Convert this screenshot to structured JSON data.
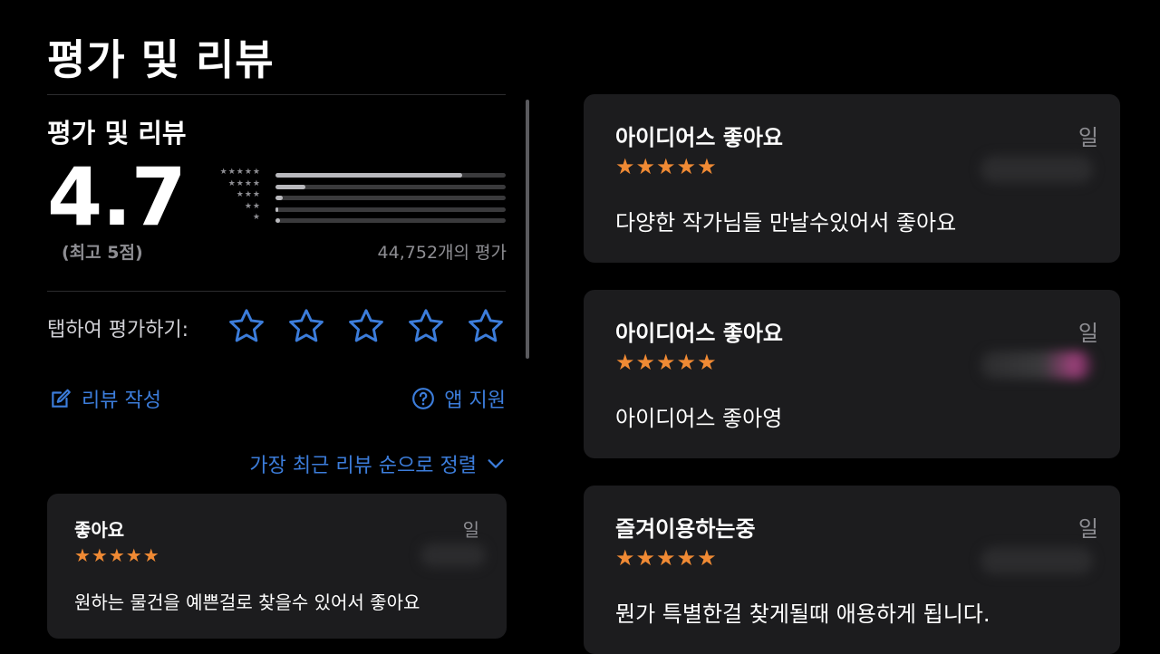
{
  "page": {
    "title": "평가 및 리뷰"
  },
  "summary": {
    "title": "평가 및 리뷰",
    "rating": "4.7",
    "out_of": "(최고 5점)",
    "count_text": "44,752개의 평가",
    "histogram": [
      {
        "stars": "★★★★★",
        "fraction": 0.81
      },
      {
        "stars": "★★★★",
        "fraction": 0.13
      },
      {
        "stars": "★★★",
        "fraction": 0.03
      },
      {
        "stars": "★★",
        "fraction": 0.01
      },
      {
        "stars": "★",
        "fraction": 0.02
      }
    ]
  },
  "tap_to_rate": {
    "label": "탭하여 평가하기:",
    "stars": 5
  },
  "actions": {
    "write_review": "리뷰 작성",
    "app_support": "앱 지원",
    "sort": "가장 최근 리뷰 순으로 정렬"
  },
  "reviews_left": [
    {
      "title": "좋아요",
      "date": "일",
      "stars": "★★★★★",
      "body": "원하는 물건을 예쁜걸로 찾을수 있어서 좋아요"
    }
  ],
  "reviews_right": [
    {
      "title": "아이디어스 좋아요",
      "date": "일",
      "stars": "★★★★★",
      "body": "다양한 작가님들 만날수있어서 좋아요"
    },
    {
      "title": "아이디어스 좋아요",
      "date": "일",
      "stars": "★★★★★",
      "body": "아이디어스 좋아영"
    },
    {
      "title": "즐겨이용하는중",
      "date": "일",
      "stars": "★★★★★",
      "body": "뭔가 특별한걸 찾게될때 애용하게 됩니다."
    }
  ],
  "colors": {
    "accent": "#3c7ddb",
    "star": "#f08a34",
    "card": "#1c1c1e",
    "background": "#000000"
  },
  "icons": {
    "write": "compose-icon",
    "support": "question-circle-icon",
    "sort": "chevron-down-icon",
    "tap_star": "star-outline-icon"
  }
}
